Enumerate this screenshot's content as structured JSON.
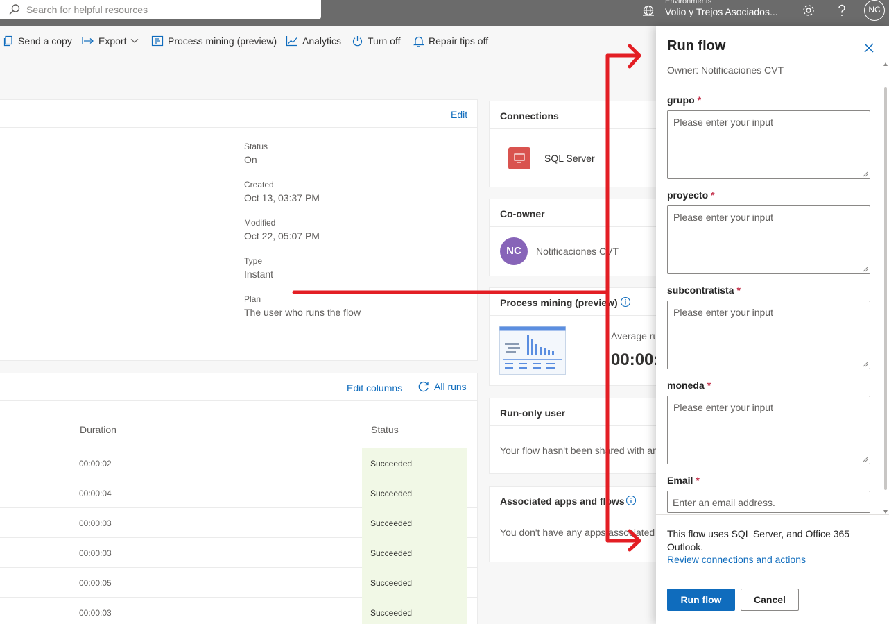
{
  "topbar": {
    "search_placeholder": "Search for helpful resources",
    "environment_label": "Environments",
    "environment_name": "Volio y Trejos Asociados...",
    "avatar_initials": "NC"
  },
  "commands": {
    "send_copy": "Send a copy",
    "export": "Export",
    "process_mining": "Process mining (preview)",
    "analytics": "Analytics",
    "turn_off": "Turn off",
    "repair_tips": "Repair tips off"
  },
  "details": {
    "edit": "Edit",
    "fields": [
      {
        "label": "Status",
        "value": "On"
      },
      {
        "label": "Created",
        "value": "Oct 13, 03:37 PM"
      },
      {
        "label": "Modified",
        "value": "Oct 22, 05:07 PM"
      },
      {
        "label": "Type",
        "value": "Instant"
      },
      {
        "label": "Plan",
        "value": "The user who runs the flow"
      }
    ]
  },
  "runs": {
    "edit_columns": "Edit columns",
    "all_runs": "All runs",
    "col_duration": "Duration",
    "col_status": "Status",
    "rows": [
      {
        "duration": "00:00:02",
        "status": "Succeeded"
      },
      {
        "duration": "00:00:04",
        "status": "Succeeded"
      },
      {
        "duration": "00:00:03",
        "status": "Succeeded"
      },
      {
        "duration": "00:00:03",
        "status": "Succeeded"
      },
      {
        "duration": "00:00:05",
        "status": "Succeeded"
      },
      {
        "duration": "00:00:03",
        "status": "Succeeded"
      }
    ]
  },
  "connections": {
    "title": "Connections",
    "item": "SQL Server"
  },
  "coowner": {
    "title": "Co-owner",
    "initials": "NC",
    "name": "Notificaciones CVT"
  },
  "process_mining": {
    "title": "Process mining (preview)",
    "avg_label": "Average ru",
    "avg_value": "00:00:"
  },
  "run_only": {
    "title": "Run-only user",
    "text": "Your flow hasn't been shared with an"
  },
  "associated": {
    "title": "Associated apps and flows",
    "text": "You don't have any apps associated w"
  },
  "panel": {
    "title": "Run flow",
    "owner": "Owner: Notificaciones CVT",
    "required_mark": "*",
    "fields": [
      {
        "label": "grupo",
        "placeholder": "Please enter your input"
      },
      {
        "label": "proyecto",
        "placeholder": "Please enter your input"
      },
      {
        "label": "subcontratista",
        "placeholder": "Please enter your input"
      },
      {
        "label": "moneda",
        "placeholder": "Please enter your input"
      }
    ],
    "email_label": "Email",
    "email_placeholder": "Enter an email address.",
    "footer_text": "This flow uses SQL Server, and Office 365 Outlook.",
    "review_link": "Review connections and actions",
    "run_button": "Run flow",
    "cancel_button": "Cancel"
  },
  "colors": {
    "accent": "#0f6cbd",
    "success_bg": "#f1f8e6",
    "annotation": "#e31e24",
    "coowner_avatar": "#8764b8",
    "sql_icon": "#d9534f"
  }
}
